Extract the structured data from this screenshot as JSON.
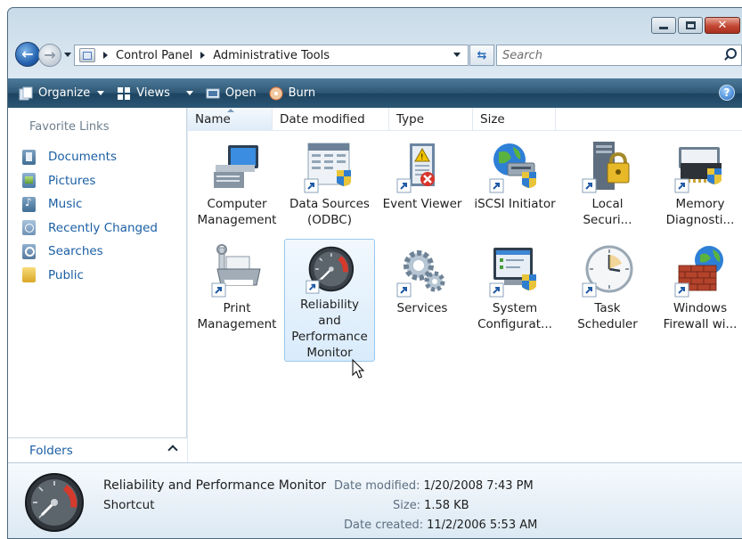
{
  "address": {
    "crumbs": [
      "Control Panel",
      "Administrative Tools"
    ]
  },
  "search": {
    "placeholder": "Search"
  },
  "toolbar": {
    "organize": "Organize",
    "views": "Views",
    "open": "Open",
    "burn": "Burn",
    "help": "?"
  },
  "nav": {
    "heading": "Favorite Links",
    "items": [
      {
        "label": "Documents",
        "icon": "documents-icon"
      },
      {
        "label": "Pictures",
        "icon": "pictures-icon"
      },
      {
        "label": "Music",
        "icon": "music-icon"
      },
      {
        "label": "Recently Changed",
        "icon": "recently-changed-icon"
      },
      {
        "label": "Searches",
        "icon": "searches-icon"
      },
      {
        "label": "Public",
        "icon": "public-folder-icon"
      }
    ],
    "folders": "Folders"
  },
  "columns": {
    "name": "Name",
    "date": "Date modified",
    "type": "Type",
    "size": "Size"
  },
  "items": [
    {
      "label": "Computer\nManagement",
      "icon": "computer-management-icon"
    },
    {
      "label": "Data Sources\n(ODBC)",
      "icon": "data-sources-icon"
    },
    {
      "label": "Event Viewer",
      "icon": "event-viewer-icon"
    },
    {
      "label": "iSCSI Initiator",
      "icon": "iscsi-initiator-icon"
    },
    {
      "label": "Local\nSecuri...",
      "icon": "local-security-icon"
    },
    {
      "label": "Memory\nDiagnosti...",
      "icon": "memory-diagnostics-icon"
    },
    {
      "label": "Print\nManagement",
      "icon": "print-management-icon"
    },
    {
      "label": "Reliability\nand\nPerformance\nMonitor",
      "icon": "reliability-monitor-icon",
      "selected": true
    },
    {
      "label": "Services",
      "icon": "services-icon"
    },
    {
      "label": "System\nConfigurat...",
      "icon": "system-configuration-icon"
    },
    {
      "label": "Task\nScheduler",
      "icon": "task-scheduler-icon"
    },
    {
      "label": "Windows\nFirewall wi...",
      "icon": "windows-firewall-icon"
    }
  ],
  "details": {
    "name": "Reliability and Performance Monitor",
    "type": "Shortcut",
    "date_modified_label": "Date modified:",
    "date_modified": "1/20/2008 7:43 PM",
    "size_label": "Size:",
    "size": "1.58 KB",
    "date_created_label": "Date created:",
    "date_created": "11/2/2006 5:53 AM"
  },
  "colors": {
    "toolbar": "#2d5673",
    "link": "#1b5fa4",
    "selection": "#d9ebfb"
  }
}
